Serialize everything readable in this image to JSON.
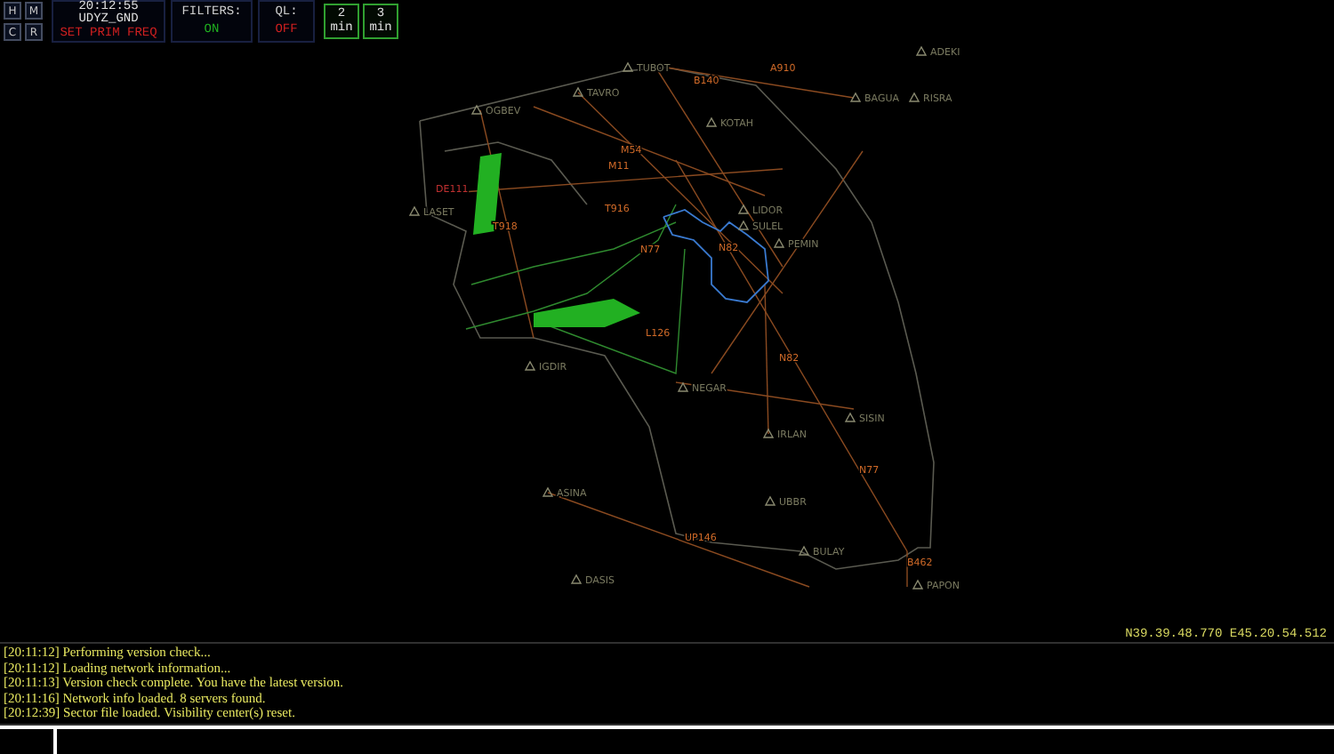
{
  "toolbar": {
    "mode_buttons": [
      "H",
      "M",
      "C",
      "R"
    ],
    "clock": "20:12:55",
    "callsign": "UDYZ_GND",
    "frequency_prompt": "SET PRIM FREQ",
    "filters": {
      "label": "FILTERS:",
      "value": "ON",
      "on": true
    },
    "quick_look": {
      "label": "QL:",
      "value": "OFF",
      "on": false
    },
    "range_buttons": [
      {
        "value": "2",
        "unit": "min"
      },
      {
        "value": "3",
        "unit": "min"
      }
    ]
  },
  "map": {
    "waypoints": [
      "ADEKI",
      "BAGUA",
      "RISRA",
      "TUBOT",
      "TAVRO",
      "OGBEV",
      "KOTAH",
      "LIDOR",
      "SULEL",
      "PEMIN",
      "LASET",
      "IGDIR",
      "NEGAR",
      "SISIN",
      "IRLAN",
      "ASINA",
      "UBBR",
      "DASIS",
      "BULAY",
      "PAPON"
    ],
    "airways": [
      "A910",
      "B140",
      "M54",
      "M11",
      "T916",
      "T918",
      "N77",
      "N82",
      "N82",
      "L126",
      "N77",
      "UP146",
      "B462"
    ],
    "restricted_areas": [
      "DE111"
    ]
  },
  "cursor_position": "N39.39.48.770 E45.20.54.512",
  "messages": [
    "[20:11:12] Performing version check...",
    "[20:11:12] Loading network information...",
    "[20:11:13] Version check complete. You have the latest version.",
    "[20:11:16] Network info loaded. 8 servers found.",
    "[20:12:39] Sector file loaded. Visibility center(s) reset."
  ]
}
